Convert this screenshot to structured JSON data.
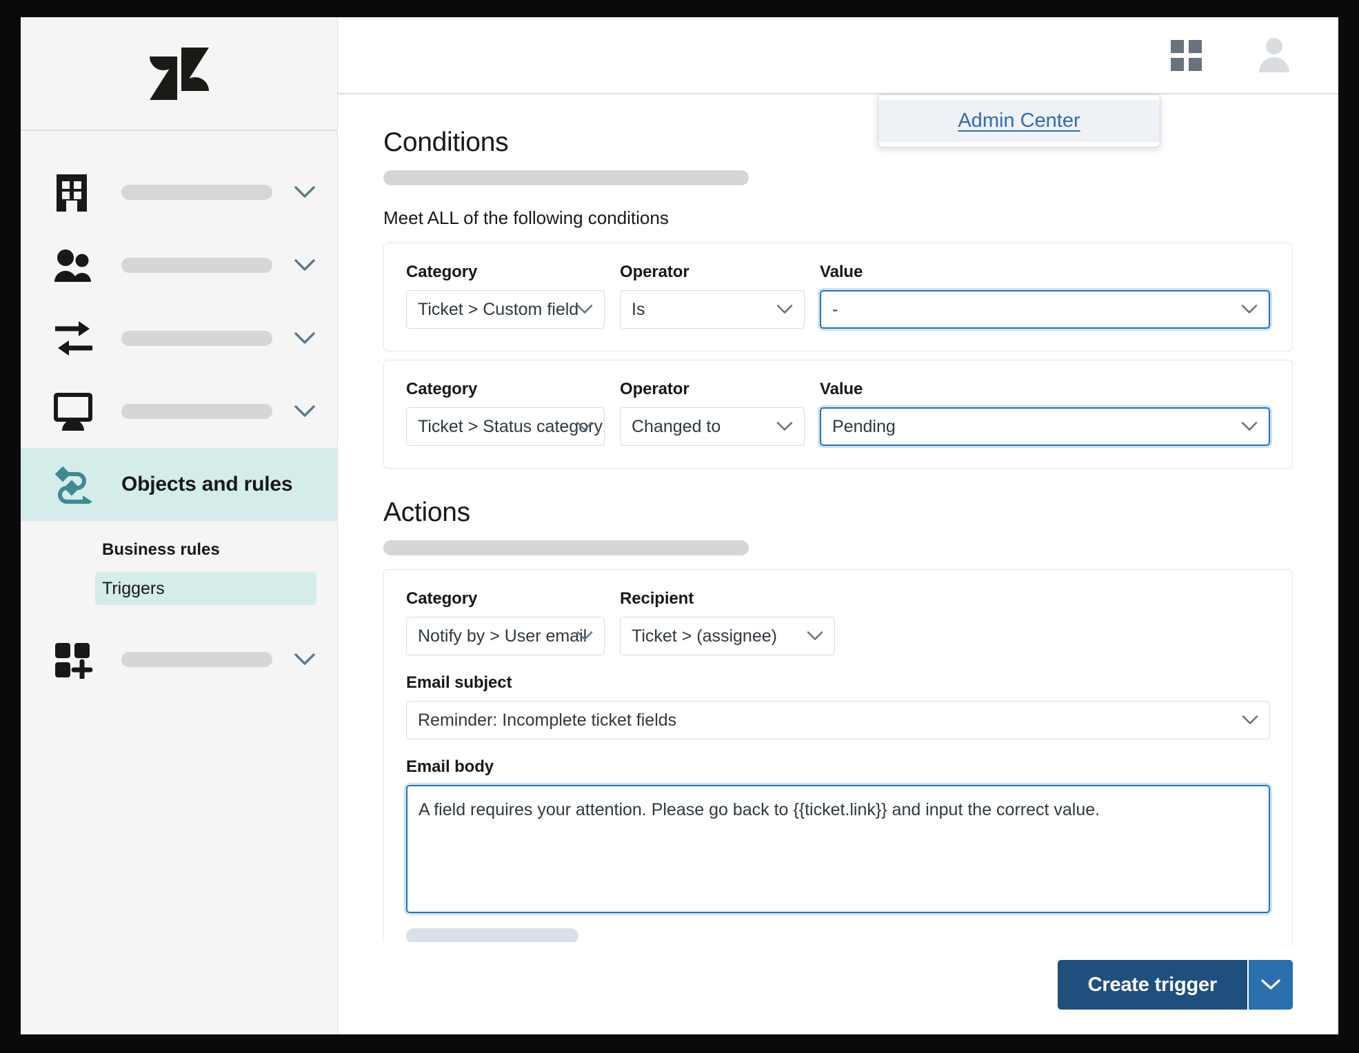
{
  "topbar": {
    "grid_icon": "apps-grid-icon",
    "avatar_icon": "user-avatar-icon",
    "admin_center_link": "Admin Center"
  },
  "sidebar": {
    "logo": "zendesk-logo",
    "items": [
      {
        "icon": "building-icon",
        "label": "",
        "skeleton": true,
        "active": false
      },
      {
        "icon": "people-icon",
        "label": "",
        "skeleton": true,
        "active": false
      },
      {
        "icon": "arrows-exchange-icon",
        "label": "",
        "skeleton": true,
        "active": false
      },
      {
        "icon": "monitor-icon",
        "label": "",
        "skeleton": true,
        "active": false
      },
      {
        "icon": "objects-rules-icon",
        "label": "Objects and rules",
        "skeleton": false,
        "active": true
      },
      {
        "icon": "apps-add-icon",
        "label": "",
        "skeleton": true,
        "active": false
      }
    ],
    "sub_header": "Business rules",
    "sub_items": [
      {
        "label": "Triggers",
        "active": true
      }
    ]
  },
  "conditions": {
    "title": "Conditions",
    "meet_all": "Meet ALL of the following conditions",
    "rows": [
      {
        "category_label": "Category",
        "category_value": "Ticket > Custom field",
        "operator_label": "Operator",
        "operator_value": "Is",
        "value_label": "Value",
        "value_value": "-",
        "value_focused": true
      },
      {
        "category_label": "Category",
        "category_value": "Ticket > Status category",
        "operator_label": "Operator",
        "operator_value": "Changed to",
        "value_label": "Value",
        "value_value": "Pending",
        "value_focused": true
      }
    ]
  },
  "actions": {
    "title": "Actions",
    "category_label": "Category",
    "category_value": "Notify by > User email",
    "recipient_label": "Recipient",
    "recipient_value": "Ticket > (assignee)",
    "email_subject_label": "Email subject",
    "email_subject_value": "Reminder: Incomplete ticket fields",
    "email_body_label": "Email body",
    "email_body_value": "A field requires your attention. Please go back to {{ticket.link}} and input the correct value."
  },
  "footer": {
    "create_label": "Create trigger",
    "split_icon": "chevron-down-icon"
  },
  "colors": {
    "accent_teal": "#d4ecea",
    "link_blue": "#2f6bb0",
    "focus_blue": "#1f73b7",
    "primary_button": "#1f4f7c",
    "split_button": "#2a6fae"
  }
}
